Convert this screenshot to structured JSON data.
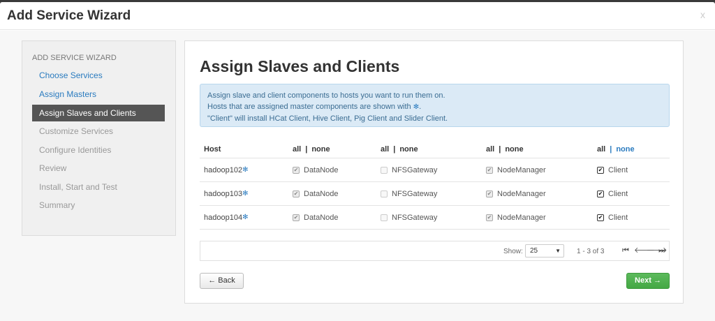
{
  "window": {
    "title": "Add Service Wizard",
    "close_label": "x"
  },
  "sidebar": {
    "header": "ADD SERVICE WIZARD",
    "items": [
      {
        "label": "Choose Services",
        "state": "link"
      },
      {
        "label": "Assign Masters",
        "state": "link"
      },
      {
        "label": "Assign Slaves and Clients",
        "state": "active"
      },
      {
        "label": "Customize Services",
        "state": "disabled"
      },
      {
        "label": "Configure Identities",
        "state": "disabled"
      },
      {
        "label": "Review",
        "state": "disabled"
      },
      {
        "label": "Install, Start and Test",
        "state": "disabled"
      },
      {
        "label": "Summary",
        "state": "disabled"
      }
    ]
  },
  "main": {
    "title": "Assign Slaves and Clients",
    "info": {
      "line1": "Assign slave and client components to hosts you want to run them on.",
      "line2": "Hosts that are assigned master components are shown with",
      "line2_icon": "✻",
      "line2_end": ".",
      "line3": "\"Client\" will install HCat Client, Hive Client, Pig Client and Slider Client."
    },
    "grid": {
      "host_header": "Host",
      "col_all": "all",
      "col_sep": "|",
      "col_none": "none",
      "master_marker": "✻",
      "rows": [
        {
          "host": "hadoop102",
          "c1": "DataNode",
          "c2": "NFSGateway",
          "c3": "NodeManager",
          "c4": "Client"
        },
        {
          "host": "hadoop103",
          "c1": "DataNode",
          "c2": "NFSGateway",
          "c3": "NodeManager",
          "c4": "Client"
        },
        {
          "host": "hadoop104",
          "c1": "DataNode",
          "c2": "NFSGateway",
          "c3": "NodeManager",
          "c4": "Client"
        }
      ]
    },
    "pager": {
      "show_label": "Show:",
      "page_size": "25",
      "range": "1 - 3 of 3"
    },
    "back_label": "← Back",
    "next_label": "Next →"
  },
  "colors": {
    "accent": "#2a7bbf",
    "success": "#44a844",
    "active_nav": "#555555",
    "info_bg": "#dbeaf6"
  }
}
